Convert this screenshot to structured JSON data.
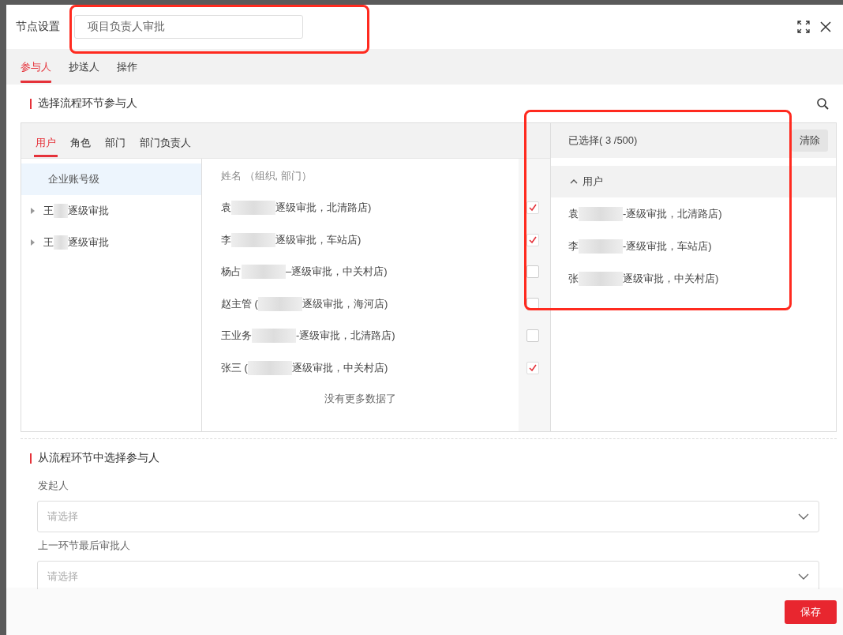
{
  "dialog": {
    "title": "节点设置",
    "name_value": "项目负责人审批"
  },
  "tabs": [
    {
      "label": "参与人",
      "selected": true
    },
    {
      "label": "抄送人",
      "selected": false
    },
    {
      "label": "操作",
      "selected": false
    }
  ],
  "participants": {
    "title": "选择流程环节参与人",
    "type_tabs": [
      {
        "label": "用户",
        "selected": true
      },
      {
        "label": "角色",
        "selected": false
      },
      {
        "label": "部门",
        "selected": false
      },
      {
        "label": "部门负责人",
        "selected": false
      }
    ],
    "tree_root": {
      "label": "企业账号级",
      "selected": true
    },
    "tree": [
      {
        "parts": [
          "王",
          "逐级审批"
        ],
        "expanded": false
      },
      {
        "parts": [
          "王",
          "逐级审批"
        ],
        "expanded": false
      }
    ],
    "list_header": "姓名 （组织, 部门）",
    "rows": [
      {
        "parts": [
          "袁",
          "逐级审批，北清路店)"
        ],
        "checked": true
      },
      {
        "parts": [
          "李",
          "逐级审批，车站店)"
        ],
        "checked": true
      },
      {
        "parts": [
          "杨占",
          "–逐级审批，中关村店)"
        ],
        "checked": false
      },
      {
        "parts": [
          "赵主管 (",
          "逐级审批，海河店)"
        ],
        "checked": false
      },
      {
        "parts": [
          "王业务",
          "-逐级审批，北清路店)"
        ],
        "checked": false
      },
      {
        "parts": [
          "张三 (",
          "逐级审批，中关村店)"
        ],
        "checked": true
      }
    ],
    "end_note": "没有更多数据了",
    "selected_title": "已选择( 3 /500)",
    "clear_button": "清除",
    "selected_group": {
      "label": "用户",
      "expanded": true
    },
    "selected_items": [
      {
        "parts": [
          "袁",
          "-逐级审批，北清路店)"
        ]
      },
      {
        "parts": [
          "李",
          "-逐级审批，车站店)"
        ]
      },
      {
        "parts": [
          "张",
          "逐级审批，中关村店)"
        ]
      }
    ]
  },
  "from_steps": {
    "title": "从流程环节中选择参与人",
    "fields": [
      {
        "label": "发起人",
        "placeholder": "请选择"
      },
      {
        "label": "上一环节最后审批人",
        "placeholder": "请选择"
      }
    ]
  },
  "footer": {
    "save_button": "保存"
  }
}
